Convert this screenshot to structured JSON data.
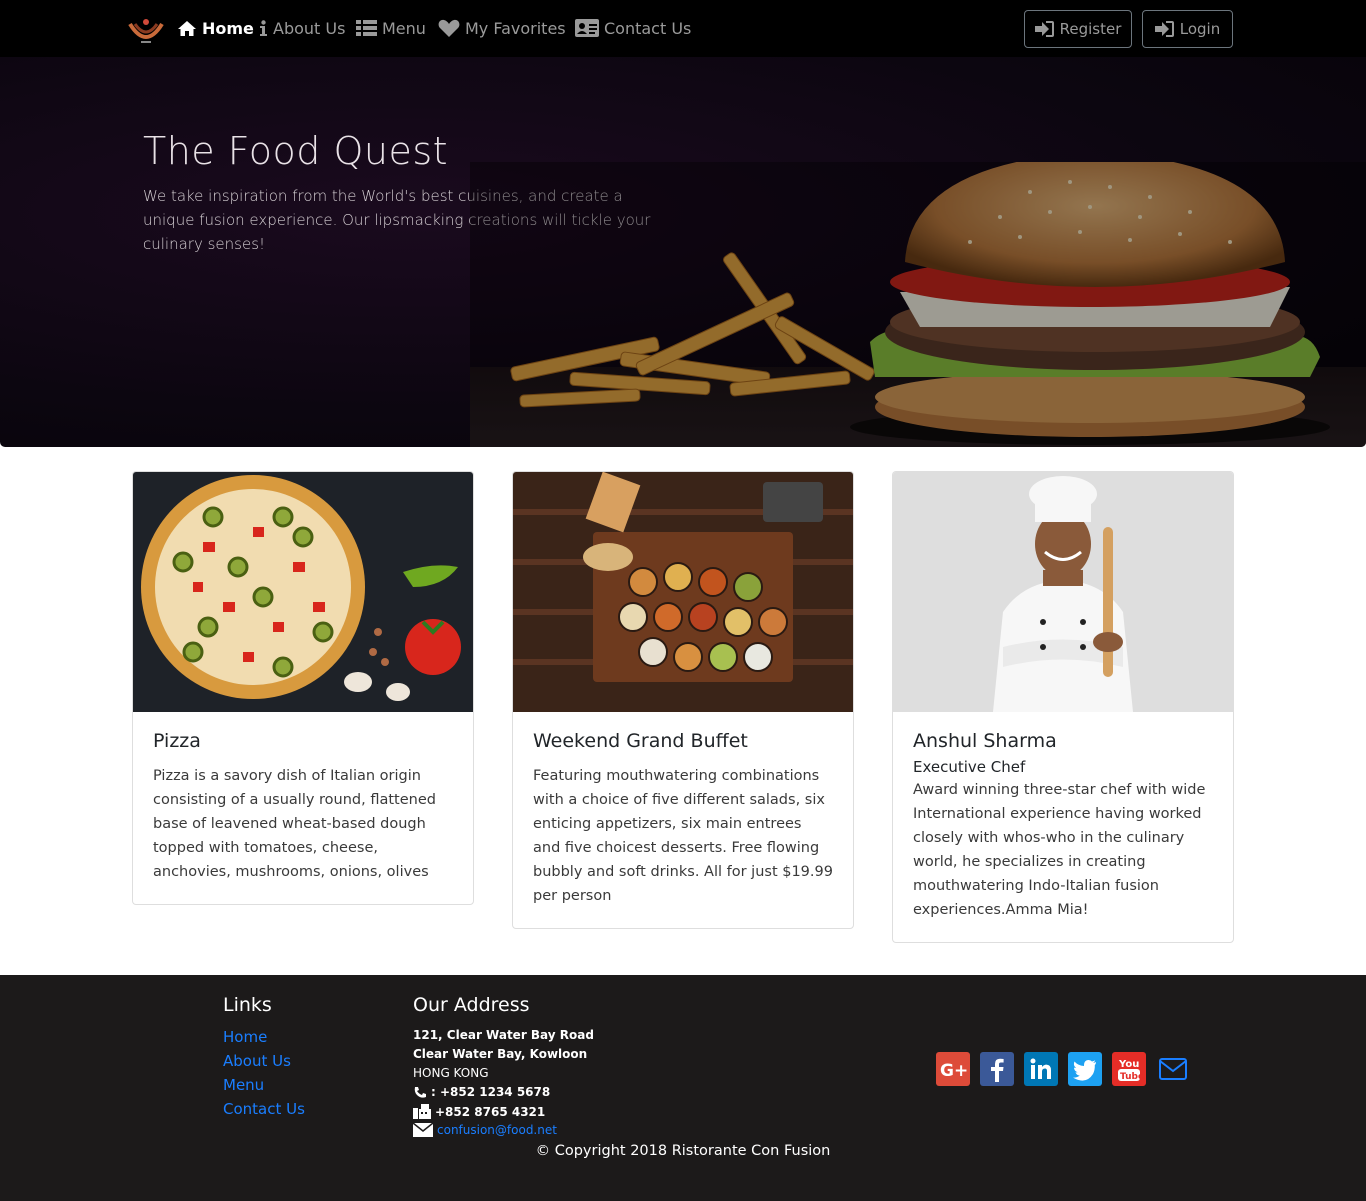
{
  "nav": {
    "logo_icon": "restaurant-logo",
    "items": [
      {
        "label": "Home",
        "icon": "home-icon"
      },
      {
        "label": "About Us",
        "icon": "info-icon"
      },
      {
        "label": "Menu",
        "icon": "list-icon"
      },
      {
        "label": "My Favorites",
        "icon": "heart-icon"
      },
      {
        "label": "Contact Us",
        "icon": "address-card-icon"
      }
    ],
    "register_label": "Register",
    "login_label": "Login"
  },
  "hero": {
    "title": "The Food Quest",
    "text": "We take inspiration from the World's best cuisines, and create a unique fusion experience. Our lipsmacking creations will tickle your culinary senses!"
  },
  "cards": [
    {
      "title": "Pizza",
      "subtitle": "",
      "text": "Pizza is a savory dish of Italian origin consisting of a usually round, flattened base of leavened wheat-based dough topped with tomatoes, cheese, anchovies, mushrooms, onions, olives"
    },
    {
      "title": "Weekend Grand Buffet",
      "subtitle": "",
      "text": "Featuring mouthwatering combinations with a choice of five different salads, six enticing appetizers, six main entrees and five choicest desserts. Free flowing bubbly and soft drinks. All for just $19.99 per person"
    },
    {
      "title": "Anshul Sharma",
      "subtitle": "Executive Chef",
      "text": "Award winning three-star chef with wide International experience having worked closely with whos-who in the culinary world, he specializes in creating mouthwatering Indo-Italian fusion experiences.Amma Mia!"
    }
  ],
  "footer": {
    "links_heading": "Links",
    "links": [
      "Home",
      "About Us",
      "Menu",
      "Contact Us"
    ],
    "address_heading": "Our Address",
    "address_lines": [
      "121, Clear Water Bay Road",
      "Clear Water Bay, Kowloon",
      "HONG KONG"
    ],
    "phone": ": +852 1234 5678",
    "fax": " +852 8765 4321",
    "email": "confusion@food.net",
    "social": [
      {
        "icon": "google-plus-icon",
        "color": "#dd4b39"
      },
      {
        "icon": "facebook-icon",
        "color": "#3b5998"
      },
      {
        "icon": "linkedin-icon",
        "color": "#0077b5"
      },
      {
        "icon": "twitter-icon",
        "color": "#1da1f2"
      },
      {
        "icon": "youtube-icon",
        "color": "#e52d27"
      },
      {
        "icon": "envelope-icon",
        "color": "#1a7eff"
      }
    ],
    "copyright": "© Copyright 2018 Ristorante Con Fusion"
  }
}
